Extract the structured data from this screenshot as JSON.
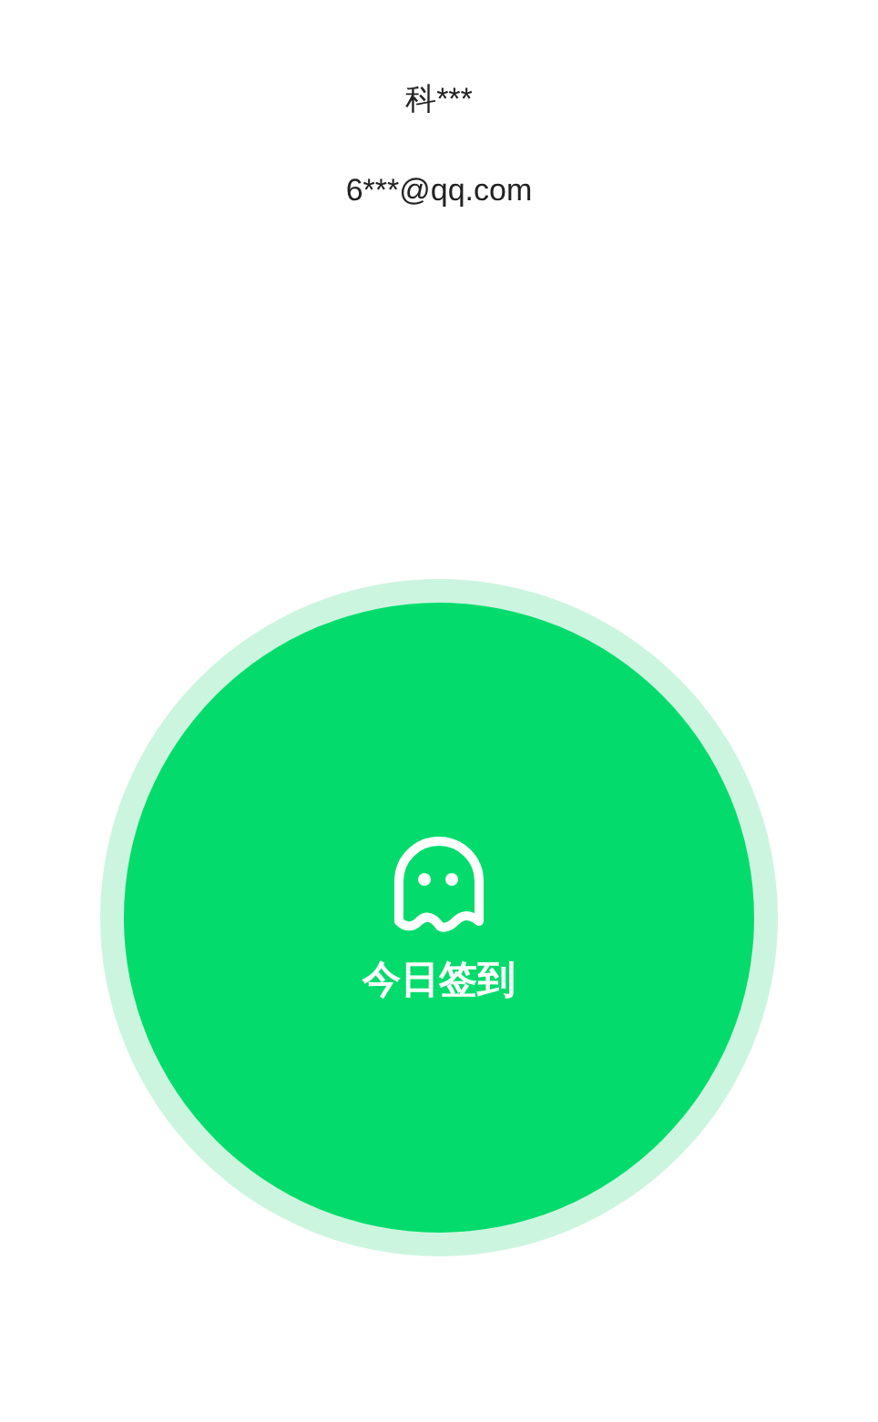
{
  "user": {
    "name": "科***",
    "email": "6***@qq.com"
  },
  "checkin_button": {
    "label": "今日签到"
  }
}
